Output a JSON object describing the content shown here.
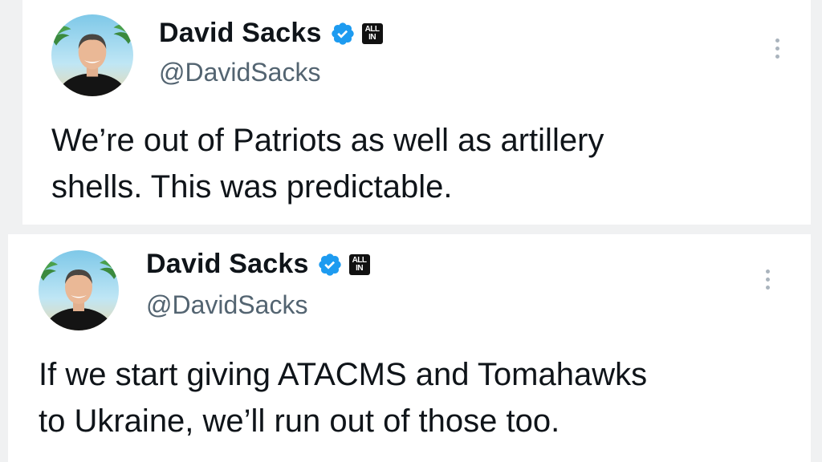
{
  "tweets": [
    {
      "author": {
        "name": "David Sacks",
        "handle": "@DavidSacks",
        "verified": true,
        "affiliation_badge": [
          "ALL",
          "IN"
        ],
        "avatar_icon": "profile-photo"
      },
      "text_lines": [
        "We’re out of Patriots as well as artillery",
        "shells. This was predictable."
      ],
      "more_icon": "more-options-icon"
    },
    {
      "author": {
        "name": "David Sacks",
        "handle": "@DavidSacks",
        "verified": true,
        "affiliation_badge": [
          "ALL",
          "IN"
        ],
        "avatar_icon": "profile-photo"
      },
      "text_lines": [
        "If we start giving ATACMS and Tomahawks",
        "to Ukraine, we’ll run out of those too."
      ],
      "more_icon": "more-options-icon"
    }
  ],
  "colors": {
    "verified_blue": "#1d9bf0",
    "text_primary": "#0f1419",
    "text_secondary": "#536471"
  }
}
